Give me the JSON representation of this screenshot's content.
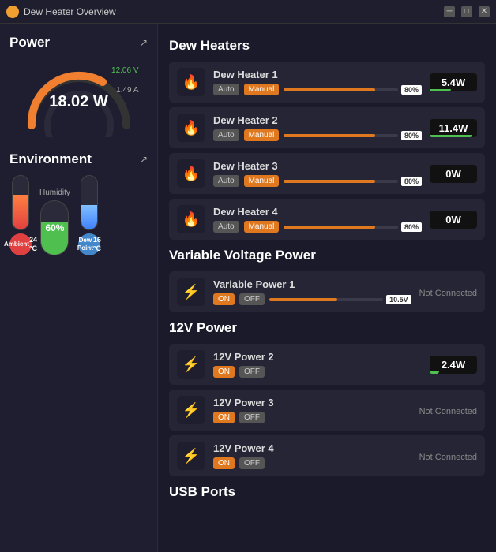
{
  "titlebar": {
    "title": "Dew Heater Overview",
    "min_label": "─",
    "max_label": "□",
    "close_label": "✕"
  },
  "left": {
    "power_section_title": "Power",
    "power_value": "18.02 W",
    "voltage_value": "12.06 V",
    "current_value": "1.49 A",
    "env_section_title": "Environment",
    "humidity_label": "Humidity",
    "humidity_value": "60%",
    "ambient_label": "Ambient",
    "ambient_value": "24 °C",
    "dew_label": "Dew Point",
    "dew_value": "16 °C"
  },
  "right": {
    "dew_heaters_title": "Dew Heaters",
    "variable_voltage_title": "Variable Voltage Power",
    "power_12v_title": "12V Power",
    "usb_title": "USB Ports",
    "dew_heaters": [
      {
        "name": "Dew Heater 1",
        "mode_auto": "Auto",
        "mode_manual": "Manual",
        "slider_pct": 80,
        "slider_label": "80%",
        "value": "5.4W",
        "bar_pct": 45
      },
      {
        "name": "Dew Heater 2",
        "mode_auto": "Auto",
        "mode_manual": "Manual",
        "slider_pct": 80,
        "slider_label": "80%",
        "value": "11.4W",
        "bar_pct": 90
      },
      {
        "name": "Dew Heater 3",
        "mode_auto": "Auto",
        "mode_manual": "Manual",
        "slider_pct": 80,
        "slider_label": "80%",
        "value": "0W",
        "bar_pct": 0
      },
      {
        "name": "Dew Heater 4",
        "mode_auto": "Auto",
        "mode_manual": "Manual",
        "slider_pct": 80,
        "slider_label": "80%",
        "value": "0W",
        "bar_pct": 0
      }
    ],
    "variable_power": [
      {
        "name": "Variable Power 1",
        "on_label": "ON",
        "off_label": "OFF",
        "slider_pct": 60,
        "slider_label": "10.5V",
        "status": "Not Connected"
      }
    ],
    "power_12v": [
      {
        "name": "12V Power 2",
        "on_label": "ON",
        "off_label": "OFF",
        "value": "2.4W",
        "bar_pct": 20
      },
      {
        "name": "12V Power 3",
        "on_label": "ON",
        "off_label": "OFF",
        "status": "Not Connected"
      },
      {
        "name": "12V Power 4",
        "on_label": "ON",
        "off_label": "OFF",
        "status": "Not Connected"
      }
    ]
  }
}
